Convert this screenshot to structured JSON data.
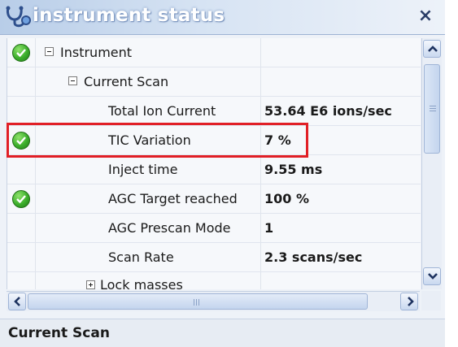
{
  "window": {
    "title": "instrument status",
    "close_label": "×"
  },
  "tree": {
    "rows": [
      {
        "label": "Instrument",
        "value": "",
        "status": "ok",
        "expander": "minus",
        "level": 0
      },
      {
        "label": "Current Scan",
        "value": "",
        "status": "",
        "expander": "minus",
        "level": 1
      },
      {
        "label": "Total Ion Current",
        "value": "53.64 E6 ions/sec",
        "status": "",
        "expander": "",
        "level": 2
      },
      {
        "label": "TIC Variation",
        "value": "7 %",
        "status": "ok",
        "expander": "",
        "level": 2
      },
      {
        "label": "Inject time",
        "value": "9.55 ms",
        "status": "",
        "expander": "",
        "level": 2
      },
      {
        "label": "AGC Target reached",
        "value": "100 %",
        "status": "ok",
        "expander": "",
        "level": 2
      },
      {
        "label": "AGC Prescan Mode",
        "value": "1",
        "status": "",
        "expander": "",
        "level": 2
      },
      {
        "label": "Scan Rate",
        "value": "2.3 scans/sec",
        "status": "",
        "expander": "",
        "level": 2
      },
      {
        "label": "Lock masses",
        "value": "",
        "status": "",
        "expander": "plus",
        "level": 1
      }
    ]
  },
  "statusbar": {
    "text": "Current Scan"
  },
  "colors": {
    "ok": "#3cae2c",
    "highlight": "#e11f26",
    "title_text": "#ffffff"
  }
}
